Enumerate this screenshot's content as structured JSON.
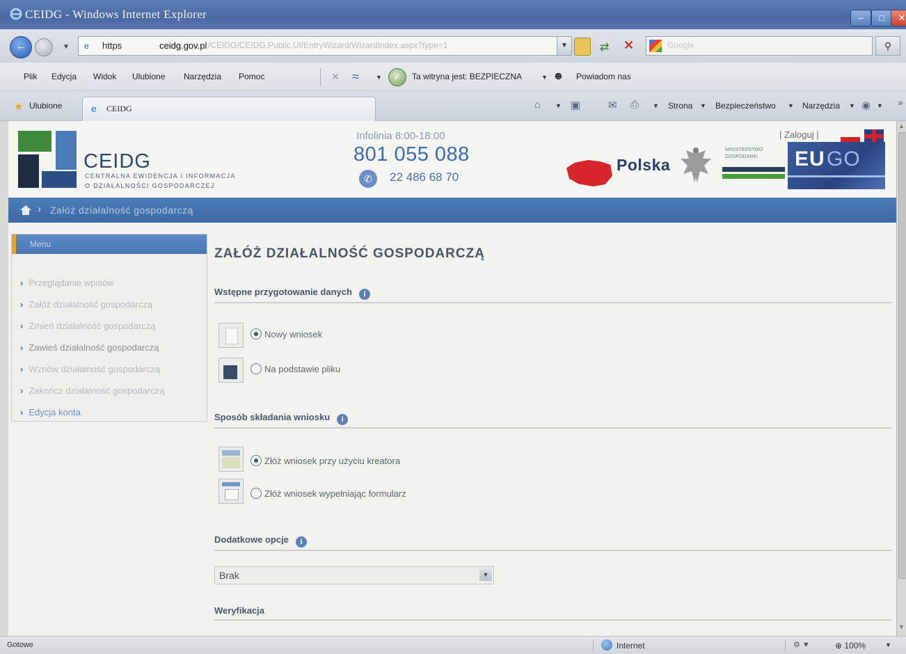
{
  "window": {
    "title": "CEIDG - Windows Internet Explorer",
    "minimize_glyph": "–",
    "maximize_glyph": "□",
    "close_glyph": "✕"
  },
  "address": {
    "protocol": "https",
    "host": "ceidg.gov.pl",
    "path": "/CEIDG/CEIDG.Public.UI/EntryWizard/WizardIndex.aspx?type=1",
    "search_placeholder": "Google"
  },
  "menubar": {
    "items": [
      "Plik",
      "Edycja",
      "Widok",
      "Ulubione",
      "Narzędzia",
      "Pomoc"
    ],
    "site_status": "Ta witryna jest: BEZPIECZNA",
    "report": "Powiadom nas"
  },
  "favbar": {
    "favorites_label": "Ulubione",
    "tab_title": "CEIDG",
    "commands": [
      "Strona",
      "Bezpieczeństwo",
      "Narzędzia"
    ]
  },
  "header": {
    "brand": "CEIDG",
    "brand_sub1": "CENTRALNA EWIDENCJA I INFORMACJA",
    "brand_sub2": "O DZIAŁALNOŚCI GOSPODARCZEJ",
    "hotline_label": "Infolinia 8:00-18:00",
    "hotline_number": "801 055 088",
    "mobile_number": "22 486 68 70",
    "login": "| Zaloguj |",
    "country": "Polska",
    "ministry_line1": "MINISTERSTWO",
    "ministry_line2": "GOSPODARKI",
    "eugo_eu": "EU",
    "eugo_go": "GO"
  },
  "breadcrumb": {
    "separator": "›",
    "current": "Załóż działalność gospodarczą"
  },
  "sidemenu": {
    "title": "Menu",
    "items": [
      "Przeglądanie wpisów",
      "Załóż działalność gospodarczą",
      "Zmień działalność gospodarczą",
      "Zawieś działalność gospodarczą",
      "Wznów działalność gospodarczą",
      "Zakończ działalność gospodarczą",
      "Edycja konta"
    ]
  },
  "main": {
    "title": "ZAŁÓŻ DZIAŁALNOŚĆ GOSPODARCZĄ",
    "section1": {
      "title": "Wstępne przygotowanie danych",
      "options": [
        "Nowy wniosek",
        "Na podstawie pliku"
      ]
    },
    "section2": {
      "title": "Sposób składania wniosku",
      "options": [
        "Złóż wniosek przy użyciu kreatora",
        "Złóż wniosek wypełniając formularz"
      ]
    },
    "section3": {
      "title": "Dodatkowe opcje",
      "selected": "Brak"
    },
    "section4": {
      "title": "Weryfikacja"
    }
  },
  "statusbar": {
    "ready": "Gotowe",
    "zone": "Internet",
    "zoom": "100%"
  },
  "colors": {
    "titlebar": "#4a69a3",
    "brand_blue": "#3c6cb0",
    "crumb_bar": "#3c69a6",
    "poland_red": "#d6262b"
  }
}
